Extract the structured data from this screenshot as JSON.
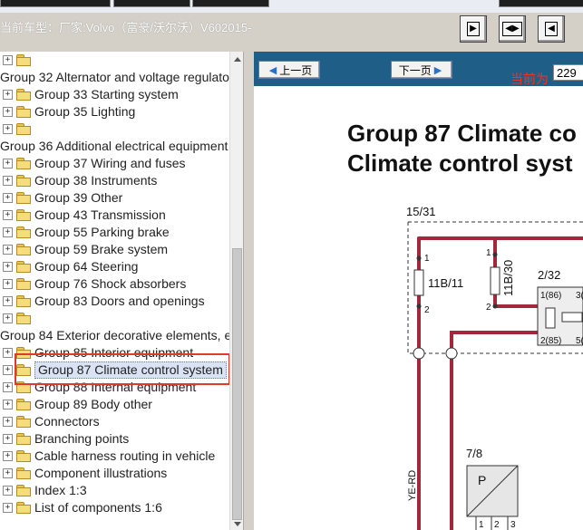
{
  "vehicle": "当前车型：厂家:Volvo（富豪/沃尔沃）V602015-",
  "toolbar": {
    "btn1_icon": "page-forward-icon",
    "btn2_icon": "two-page-icon",
    "btn3_icon": "page-back-icon"
  },
  "tree": {
    "rows": [
      {
        "label": "",
        "indent": 1,
        "kind": "folder"
      },
      {
        "label": "Group 32 Alternator and voltage regulato",
        "indent": 0,
        "kind": "text"
      },
      {
        "label": "Group 33 Starting system",
        "indent": 1,
        "kind": "folder"
      },
      {
        "label": "Group 35 Lighting",
        "indent": 1,
        "kind": "folder"
      },
      {
        "label": "",
        "indent": 1,
        "kind": "folder"
      },
      {
        "label": "Group 36 Additional electrical equipment",
        "indent": 0,
        "kind": "text"
      },
      {
        "label": "Group 37 Wiring and fuses",
        "indent": 1,
        "kind": "folder"
      },
      {
        "label": "Group 38 Instruments",
        "indent": 1,
        "kind": "folder"
      },
      {
        "label": "Group 39 Other",
        "indent": 1,
        "kind": "folder"
      },
      {
        "label": "Group 43 Transmission",
        "indent": 1,
        "kind": "folder"
      },
      {
        "label": "Group 55 Parking brake",
        "indent": 1,
        "kind": "folder"
      },
      {
        "label": "Group 59 Brake system",
        "indent": 1,
        "kind": "folder"
      },
      {
        "label": "Group 64 Steering",
        "indent": 1,
        "kind": "folder"
      },
      {
        "label": "Group 76 Shock absorbers",
        "indent": 1,
        "kind": "folder"
      },
      {
        "label": "Group 83 Doors and openings",
        "indent": 1,
        "kind": "folder"
      },
      {
        "label": "",
        "indent": 1,
        "kind": "folder"
      },
      {
        "label": "Group 84 Exterior decorative elements, e",
        "indent": 0,
        "kind": "text"
      },
      {
        "label": "Group 85 Interior equipment",
        "indent": 1,
        "kind": "folder"
      },
      {
        "label": "Group 87 Climate control system",
        "indent": 1,
        "kind": "folder",
        "selected": true
      },
      {
        "label": "Group 88 Internal equipment",
        "indent": 1,
        "kind": "folder"
      },
      {
        "label": "Group 89 Body other",
        "indent": 1,
        "kind": "folder"
      },
      {
        "label": "Connectors",
        "indent": 1,
        "kind": "folder"
      },
      {
        "label": "Branching points",
        "indent": 1,
        "kind": "folder"
      },
      {
        "label": "Cable harness routing in vehicle",
        "indent": 1,
        "kind": "folder"
      },
      {
        "label": "Component illustrations",
        "indent": 1,
        "kind": "folder"
      },
      {
        "label": "Index 1:3",
        "indent": 1,
        "kind": "folder"
      },
      {
        "label": "List of components 1:6",
        "indent": 1,
        "kind": "folder"
      }
    ]
  },
  "viewer": {
    "prev_label": "上一页",
    "next_label": "下一页",
    "current_label": "当前为",
    "page_value": "229",
    "title_line1": "Group 87 Climate co",
    "title_line2": "Climate control syst",
    "wire_color": "#a3283c"
  },
  "diagram": {
    "t1531": "15/31",
    "f11b11": "11B/11",
    "f11b30": "11B/30",
    "r232": "2/32",
    "p1_86": "1(86)",
    "p2_85": "2(85)",
    "p3": "3(",
    "p5": "5(",
    "n1a": "1",
    "n2a": "2",
    "n1b": "1",
    "n2b": "2",
    "yerd": "YE-RD",
    "c78": "7/8",
    "p_letter": "P",
    "pin1": "1",
    "pin2": "2",
    "pin3": "3"
  }
}
